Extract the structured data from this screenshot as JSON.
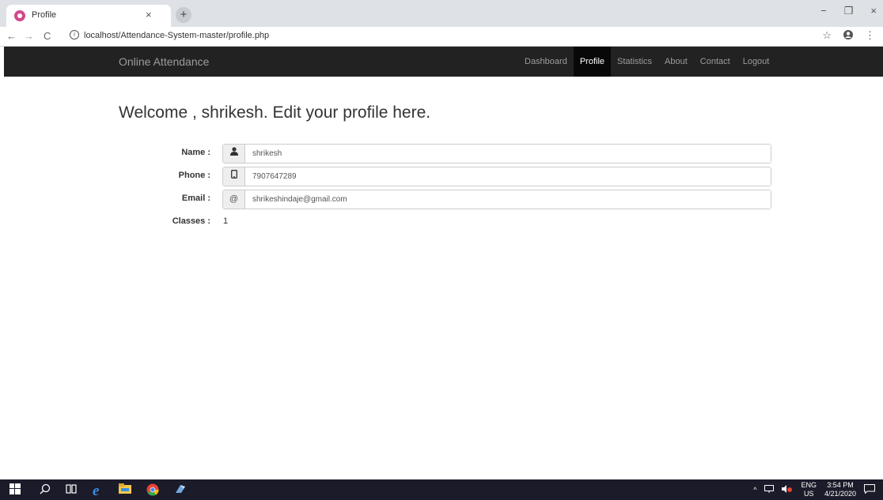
{
  "browser": {
    "tab_title": "Profile",
    "tab_close": "×",
    "new_tab": "+",
    "url": "localhost/Attendance-System-master/profile.php",
    "win_min": "−",
    "win_restore": "❐",
    "win_close": "×",
    "back": "←",
    "forward": "→",
    "reload": "C",
    "info": "i",
    "star": "☆",
    "menu": "⋮"
  },
  "navbar": {
    "brand": "Online Attendance",
    "links": [
      {
        "label": "Dashboard",
        "active": false
      },
      {
        "label": "Profile",
        "active": true
      },
      {
        "label": "Statistics",
        "active": false
      },
      {
        "label": "About",
        "active": false
      },
      {
        "label": "Contact",
        "active": false
      },
      {
        "label": "Logout",
        "active": false
      }
    ]
  },
  "main": {
    "welcome": "Welcome , shrikesh. Edit your profile here.",
    "fields": [
      {
        "label": "Name :",
        "icon": "user-icon",
        "glyph": "👤",
        "value": "shrikesh"
      },
      {
        "label": "Phone :",
        "icon": "phone-icon",
        "glyph": "▯",
        "value": "7907647289"
      },
      {
        "label": "Email :",
        "icon": "at-icon",
        "glyph": "@",
        "value": "shrikeshindaje@gmail.com"
      }
    ],
    "classes_label": "Classes :",
    "classes_value": "1"
  },
  "taskbar": {
    "lang_top": "ENG",
    "lang_bottom": "US",
    "time": "3:54 PM",
    "date": "4/21/2020",
    "up_arrow": "^"
  }
}
